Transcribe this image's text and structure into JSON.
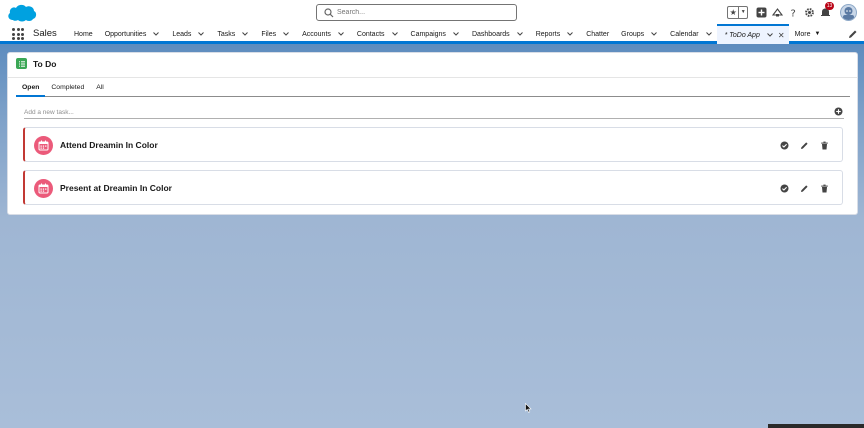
{
  "header": {
    "search_placeholder": "Search...",
    "notification_count": "13"
  },
  "nav": {
    "app_name": "Sales",
    "items": [
      {
        "label": "Home",
        "has_menu": false
      },
      {
        "label": "Opportunities",
        "has_menu": true
      },
      {
        "label": "Leads",
        "has_menu": true
      },
      {
        "label": "Tasks",
        "has_menu": true
      },
      {
        "label": "Files",
        "has_menu": true
      },
      {
        "label": "Accounts",
        "has_menu": true
      },
      {
        "label": "Contacts",
        "has_menu": true
      },
      {
        "label": "Campaigns",
        "has_menu": true
      },
      {
        "label": "Dashboards",
        "has_menu": true
      },
      {
        "label": "Reports",
        "has_menu": true
      },
      {
        "label": "Chatter",
        "has_menu": false
      },
      {
        "label": "Groups",
        "has_menu": true
      },
      {
        "label": "Calendar",
        "has_menu": true
      },
      {
        "label": "* ToDo App",
        "has_menu": true,
        "active": true,
        "closable": true
      }
    ],
    "more_label": "More"
  },
  "card": {
    "title": "To Do",
    "tabs": [
      {
        "label": "Open",
        "selected": true
      },
      {
        "label": "Completed",
        "selected": false
      },
      {
        "label": "All",
        "selected": false
      }
    ],
    "new_task_placeholder": "Add a new task...",
    "tasks": [
      {
        "title": "Attend Dreamin In Color"
      },
      {
        "title": "Present at Dreamin In Color"
      }
    ]
  },
  "colors": {
    "brand": "#0176d3",
    "todo_icon": "#3ba755",
    "task_icon": "#eb5a7a",
    "task_accent": "#c23934",
    "notification": "#ba0517"
  }
}
